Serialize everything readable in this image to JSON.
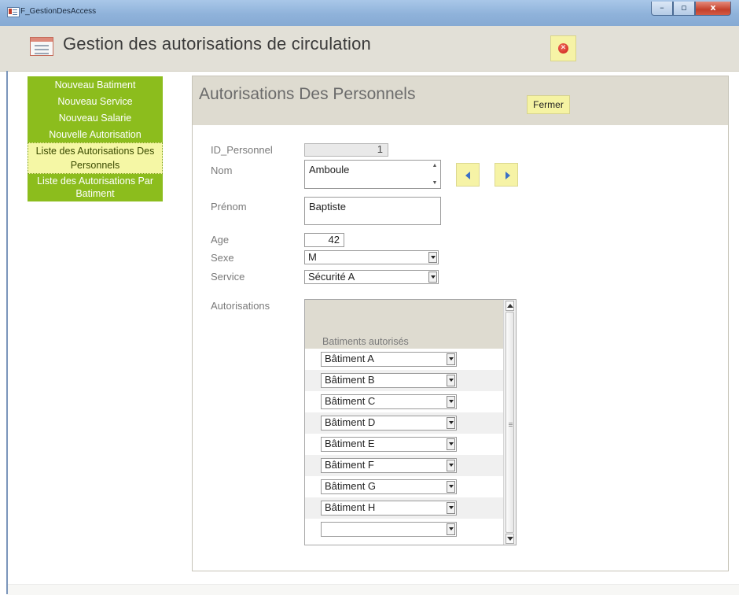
{
  "window": {
    "title": "F_GestionDesAccess",
    "buttons": [
      "–",
      "▫",
      "x"
    ]
  },
  "header": {
    "title": "Gestion des autorisations de circulation"
  },
  "nav": {
    "items": [
      {
        "label": "Nouveau Batiment"
      },
      {
        "label": "Nouveau Service"
      },
      {
        "label": "Nouveau Salarie"
      },
      {
        "label": "Nouvelle Autorisation"
      },
      {
        "label": "Liste des Autorisations Des Personnels",
        "active": true
      },
      {
        "label": "Liste des Autorisations Par Batiment"
      }
    ]
  },
  "subform": {
    "title": "Autorisations Des Personnels",
    "close_label": "Fermer",
    "labels": {
      "id": "ID_Personnel",
      "nom": "Nom",
      "prenom": "Prénom",
      "age": "Age",
      "sexe": "Sexe",
      "service": "Service",
      "autorisations": "Autorisations"
    },
    "values": {
      "id": "1",
      "nom": "Amboule",
      "prenom": "Baptiste",
      "age": "42",
      "sexe": "M",
      "service": "Sécurité A"
    },
    "authorizations": {
      "column_header": "Batiments autorisés",
      "rows": [
        "Bâtiment A",
        "Bâtiment B",
        "Bâtiment C",
        "Bâtiment D",
        "Bâtiment E",
        "Bâtiment F",
        "Bâtiment G",
        "Bâtiment H",
        ""
      ]
    }
  },
  "colors": {
    "nav_bg": "#8cbd1d",
    "nav_active_bg": "#f5f7a5",
    "header_bg": "#e2e0d7",
    "button_bg": "#f5f3a3"
  }
}
